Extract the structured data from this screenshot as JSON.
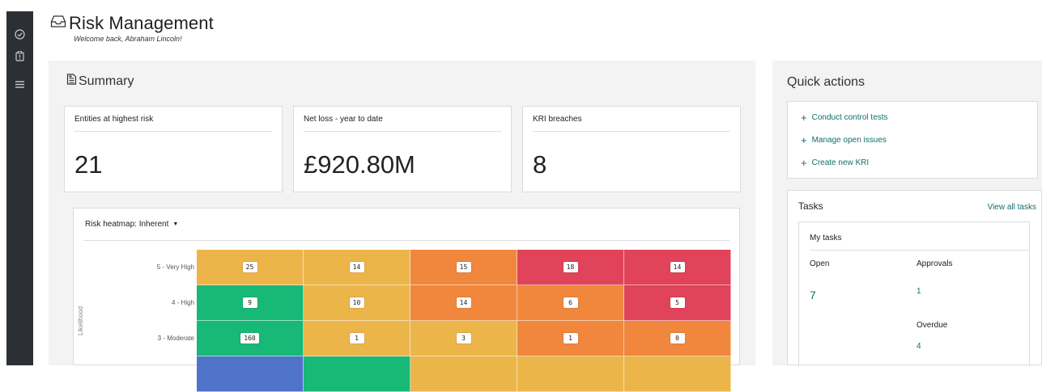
{
  "sidebar": {
    "items": [
      {
        "icon": "check-circle-icon"
      },
      {
        "icon": "clipboard-alert-icon"
      },
      {
        "icon": "list-icon"
      }
    ]
  },
  "header": {
    "icon": "inbox-icon",
    "title": "Risk Management",
    "welcome": "Welcome back, Abraham Lincoln!"
  },
  "summary": {
    "icon": "document-icon",
    "title": "Summary",
    "kpis": [
      {
        "label": "Entities at highest risk",
        "value": "21"
      },
      {
        "label": "Net loss - year to date",
        "value": "£920.80M"
      },
      {
        "label": "KRI breaches",
        "value": "8"
      }
    ],
    "heatmap": {
      "title": "Risk heatmap: Inherent",
      "y_axis_label": "Likelihood",
      "rows": [
        {
          "label": "5 - Very High",
          "cells": [
            {
              "value": "25",
              "color": "#ecb54a"
            },
            {
              "value": "14",
              "color": "#ecb54a"
            },
            {
              "value": "15",
              "color": "#f0873d"
            },
            {
              "value": "18",
              "color": "#e0435a"
            },
            {
              "value": "14",
              "color": "#e0435a"
            }
          ]
        },
        {
          "label": "4 - High",
          "cells": [
            {
              "value": "9",
              "color": "#18b877"
            },
            {
              "value": "10",
              "color": "#ecb54a"
            },
            {
              "value": "14",
              "color": "#f0873d"
            },
            {
              "value": "6",
              "color": "#f0873d"
            },
            {
              "value": "5",
              "color": "#e0435a"
            }
          ]
        },
        {
          "label": "3 - Moderate",
          "cells": [
            {
              "value": "160",
              "color": "#18b877"
            },
            {
              "value": "1",
              "color": "#ecb54a"
            },
            {
              "value": "3",
              "color": "#ecb54a"
            },
            {
              "value": "1",
              "color": "#f0873d"
            },
            {
              "value": "0",
              "color": "#f0873d"
            }
          ]
        }
      ],
      "partial_row_colors": [
        "#4f73c9",
        "#18b877",
        "#ecb54a",
        "#ecb54a",
        "#ecb54a"
      ]
    }
  },
  "quick_actions": {
    "title": "Quick actions",
    "items": [
      {
        "label": "Conduct control tests"
      },
      {
        "label": "Manage open issues"
      },
      {
        "label": "Create new KRI"
      }
    ]
  },
  "tasks": {
    "title": "Tasks",
    "view_all": "View all tasks",
    "my_tasks_label": "My tasks",
    "open_label": "Open",
    "open_value": "7",
    "approvals_label": "Approvals",
    "approvals_value": "1",
    "overdue_label": "Overdue",
    "overdue_value": "4"
  },
  "colors": {
    "accent": "#0f6f6b",
    "sidebar_bg": "#2c3035",
    "panel_bg": "#f3f3f3"
  }
}
